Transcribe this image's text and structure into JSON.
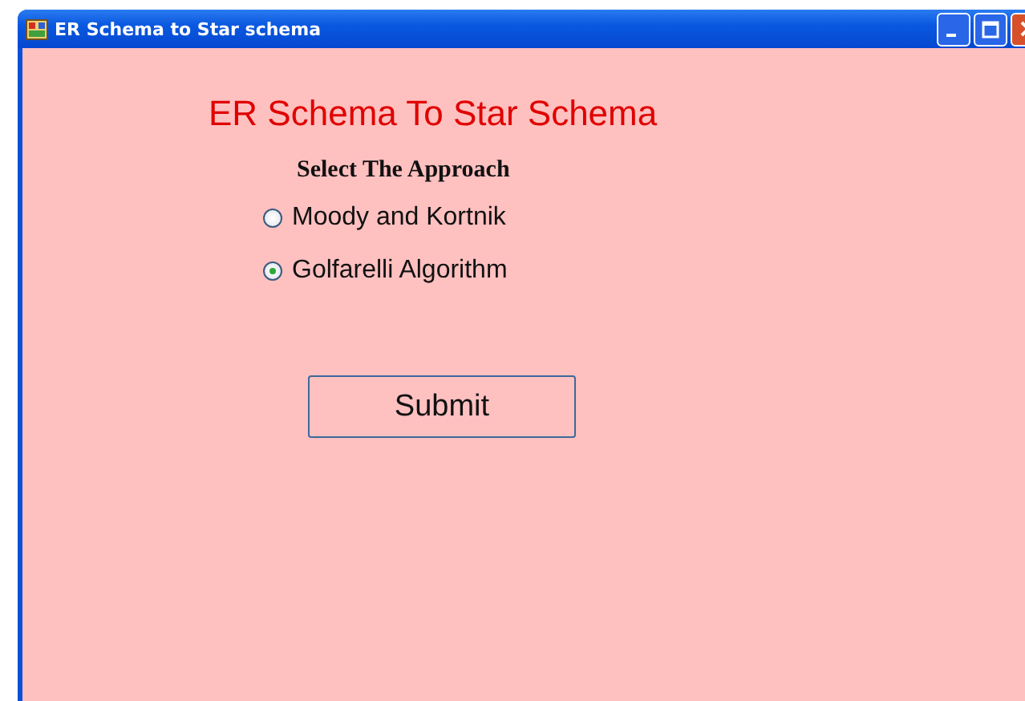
{
  "window": {
    "title": "ER Schema to Star schema"
  },
  "heading": "ER Schema To Star Schema",
  "approach_label": "Select The Approach",
  "options": [
    {
      "label": "Moody and Kortnik",
      "selected": false
    },
    {
      "label": "Golfarelli Algorithm",
      "selected": true
    }
  ],
  "buttons": [
    "Submit"
  ]
}
